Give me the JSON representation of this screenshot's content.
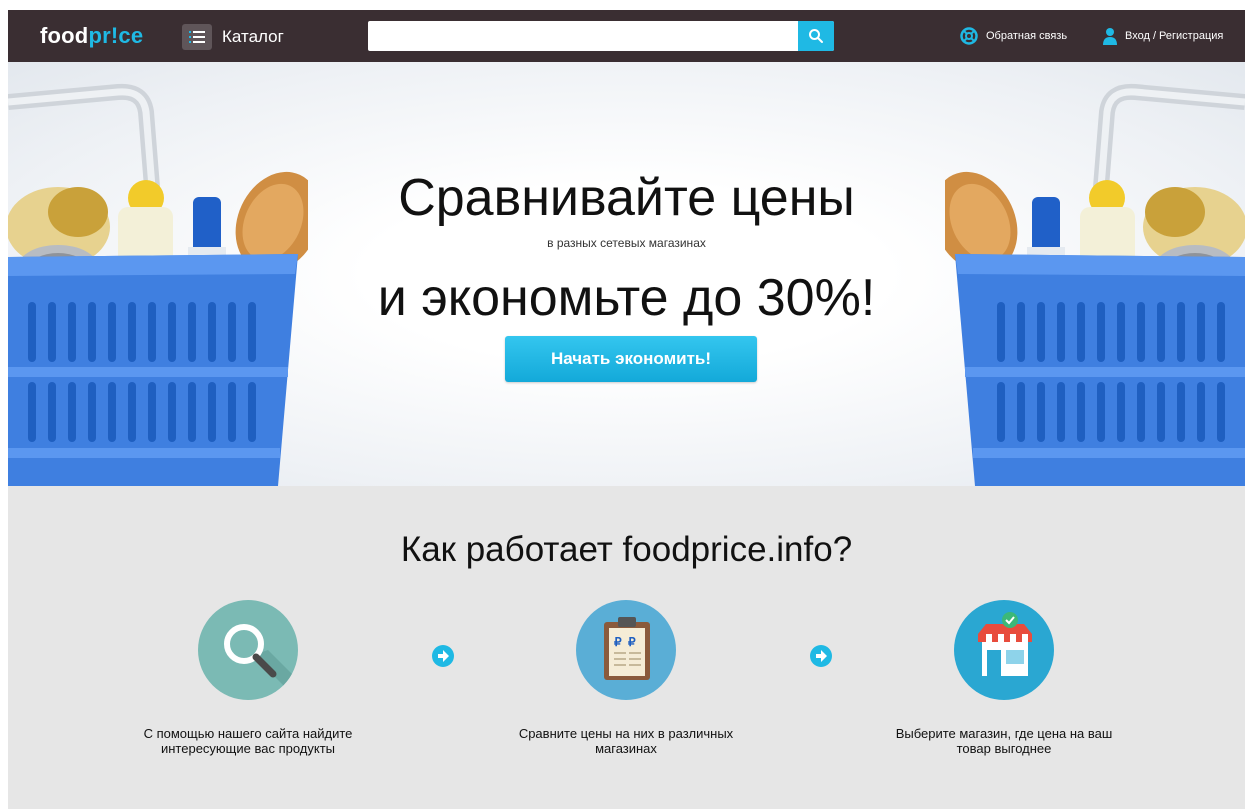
{
  "header": {
    "logo": {
      "part1": "food",
      "part2": "pr!ce"
    },
    "catalog_label": "Каталог",
    "search": {
      "value": "",
      "placeholder": ""
    },
    "feedback_label": "Обратная связь",
    "login_label": "Вход / Регистрация"
  },
  "hero": {
    "title_line1": "Сравнивайте цены",
    "subtitle": "в разных сетевых магазинах",
    "title_line2": "и экономьте до 30%!",
    "cta_label": "Начать экономить!"
  },
  "how_it_works": {
    "title": "Как работает foodprice.info?",
    "steps": [
      {
        "text": "С помощью нашего сайта найдите интересующие вас продукты",
        "icon": "magnifier-icon"
      },
      {
        "text": "Сравните цены на них в различных магазинах",
        "icon": "clipboard-prices-icon"
      },
      {
        "text": "Выберите магазин, где цена на ваш товар выгоднее",
        "icon": "shop-icon"
      }
    ]
  },
  "colors": {
    "header_bg": "#3a2e32",
    "accent": "#1fb9e4",
    "section_bg": "#e6e6e6",
    "step1_circle": "#7bbab4",
    "step2_circle": "#5aaed6",
    "step3_circle": "#2aa7d2"
  }
}
